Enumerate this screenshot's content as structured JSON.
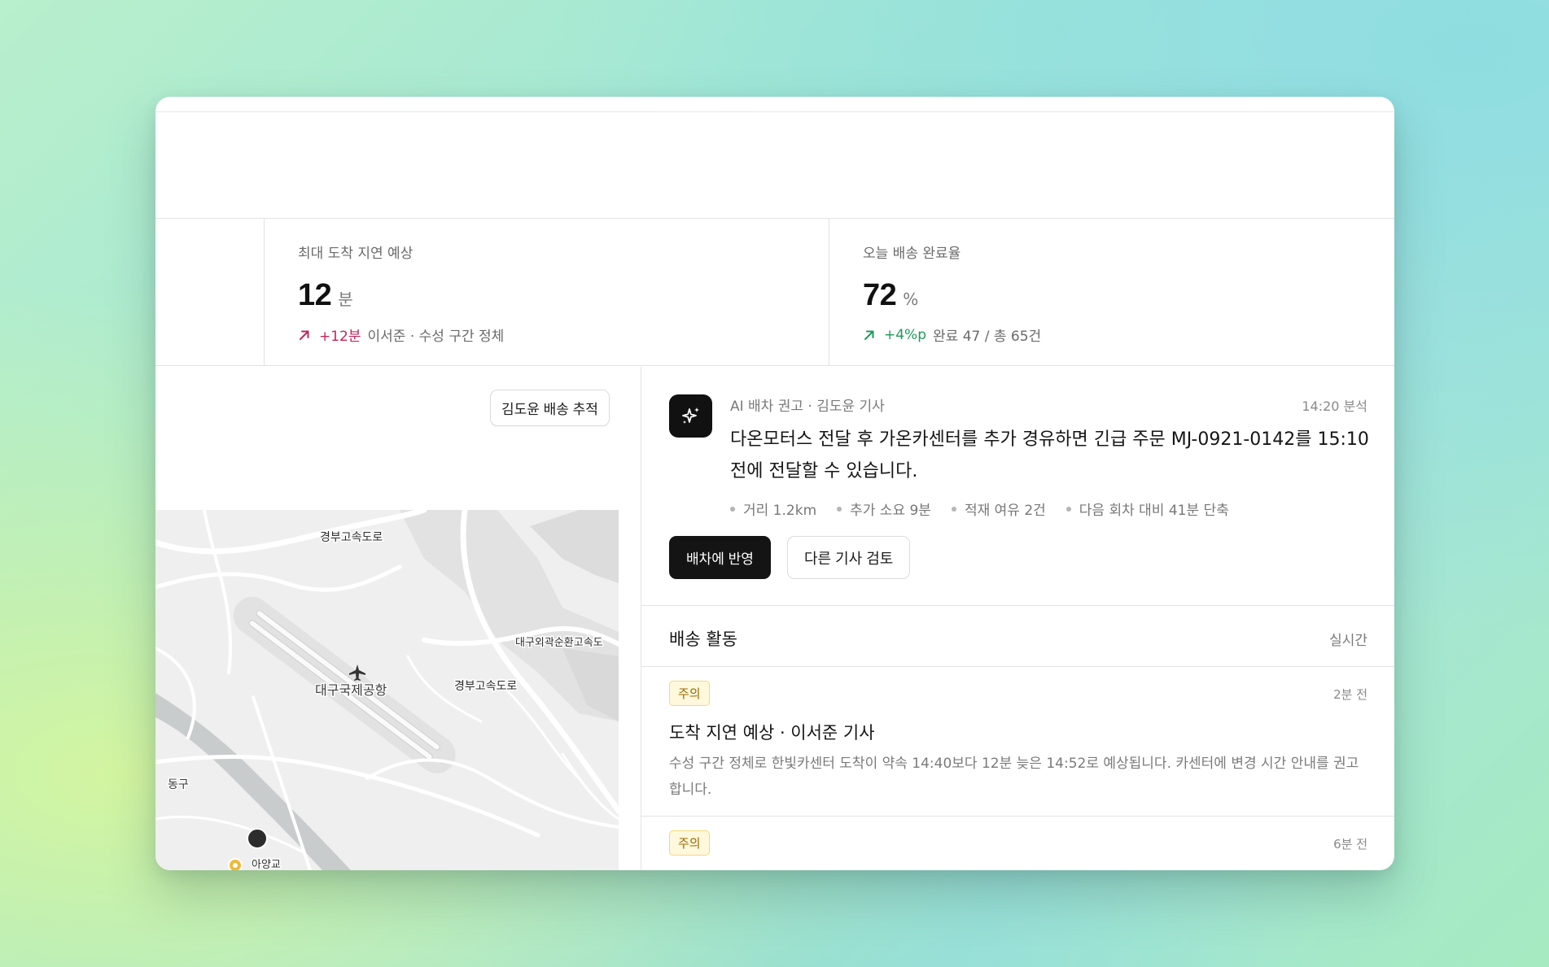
{
  "kpis": [
    {
      "label": "최대 도착 지연 예상",
      "value": "12",
      "unit": "분",
      "delta": "+12분",
      "delta_color": "#c2255c",
      "trend_icon": "arrow-up-right-icon",
      "note": "이서준 · 수성 구간 정체"
    },
    {
      "label": "오늘 배송 완료율",
      "value": "72",
      "unit": "%",
      "delta": "+4%p",
      "delta_color": "#1f9a5a",
      "trend_icon": "arrow-up-right-icon",
      "note": "완료 47 / 총 65건"
    }
  ],
  "map_panel": {
    "track_button_label": "김도윤 배송 추적",
    "labels": {
      "expressway_1": "경부고속도로",
      "expressway_2": "경부고속도로",
      "outer_ring": "대구외곽순환고속도",
      "airport": "대구국제공항",
      "district": "동구",
      "partial": "아양교"
    },
    "icons": [
      "airplane-icon",
      "vehicle-marker-icon",
      "location-pin-icon"
    ]
  },
  "ai_recommendation": {
    "icon": "sparkles-icon",
    "meta": "AI 배차 권고 · 김도윤 기사",
    "time": "14:20 분석",
    "body": "다온모터스 전달 후 가온카센터를 추가 경유하면 긴급 주문 MJ-0921-0142를 15:10 전에 전달할 수 있습니다.",
    "facts": [
      "거리 1.2km",
      "추가 소요 9분",
      "적재 여유 2건",
      "다음 회차 대비 41분 단축"
    ],
    "primary_button": "배차에 반영",
    "secondary_button": "다른 기사 검토"
  },
  "activity": {
    "title": "배송 활동",
    "live_label": "실시간",
    "items": [
      {
        "badge": "주의",
        "time": "2분 전",
        "title": "도착 지연 예상 · 이서준 기사",
        "description": "수성 구간 정체로 한빛카센터 도착이 약속 14:40보다 12분 늦은 14:52로 예상됩니다. 카센터에 변경 시간 안내를 권고합니다."
      },
      {
        "badge": "주의",
        "time": "6분 전"
      }
    ]
  },
  "colors": {
    "accent_dark": "#141414",
    "warning_bg": "#fff8dd",
    "warning_text": "#9a6a00"
  }
}
